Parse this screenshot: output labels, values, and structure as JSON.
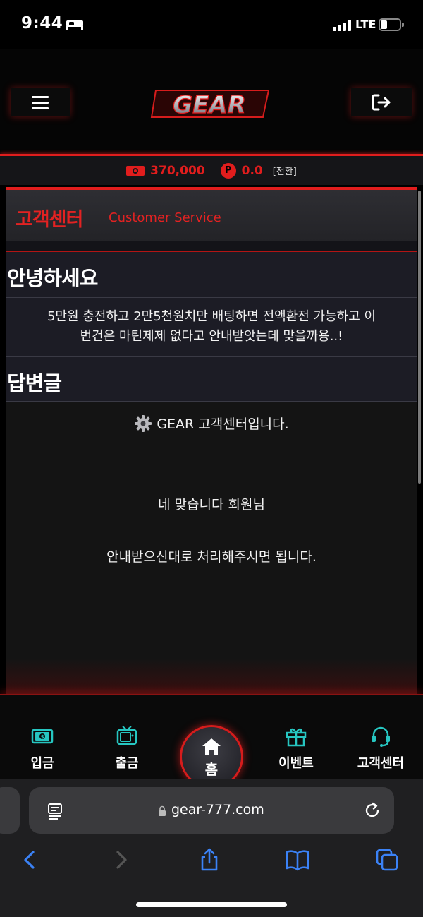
{
  "status_bar": {
    "time": "9:44",
    "network": "LTE"
  },
  "header": {
    "logo_text": "GEAR"
  },
  "balance": {
    "money": "370,000",
    "point_symbol": "P",
    "points": "0.0",
    "convert_label": "[전환]"
  },
  "page": {
    "title": "고객센터",
    "subtitle": "Customer Service"
  },
  "question": {
    "title": "안녕하세요",
    "body_line1": "5만원 충전하고 2만5천원치만 배팅하면 전액환전 가능하고 이",
    "body_line2": "번건은 마틴제제 없다고 안내받앗는데 맞을까용..!"
  },
  "answer": {
    "title": "답변글",
    "line1": "GEAR 고객센터입니다.",
    "line2": "네 맞습니다 회원님",
    "line3": "안내받으신대로 처리해주시면 됩니다."
  },
  "bottom_nav": {
    "deposit": "입금",
    "withdraw": "출금",
    "home": "홈",
    "event": "이벤트",
    "support": "고객센터"
  },
  "browser": {
    "url": "gear-777.com"
  },
  "colors": {
    "accent_red": "#e11d1d",
    "icon_teal": "#26c6c1"
  }
}
